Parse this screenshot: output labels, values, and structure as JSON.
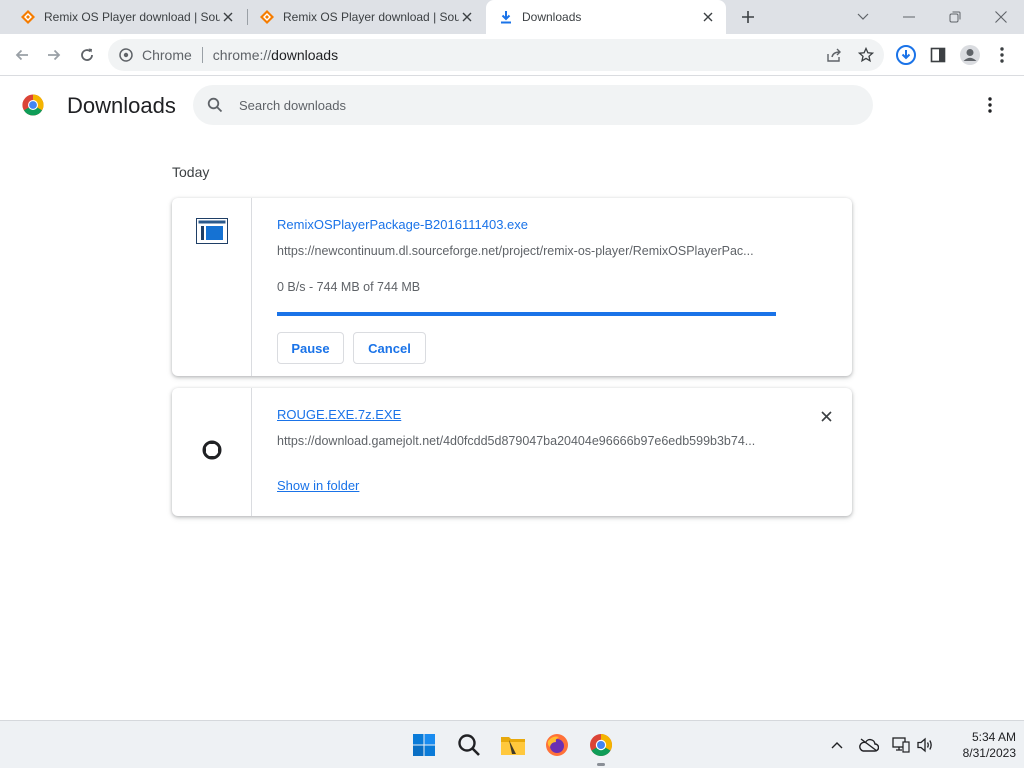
{
  "tabs": [
    {
      "title": "Remix OS Player download | SourceForge.net",
      "active": false
    },
    {
      "title": "Remix OS Player download | SourceForge.net",
      "active": false
    },
    {
      "title": "Downloads",
      "active": true
    }
  ],
  "toolbar": {
    "site_chip": "Chrome",
    "url_scheme": "chrome://",
    "url_rest": "downloads"
  },
  "page": {
    "title": "Downloads",
    "search_placeholder": "Search downloads",
    "section_date": "Today"
  },
  "downloads": [
    {
      "file_name": "RemixOSPlayerPackage-B2016111403.exe",
      "url": "https://newcontinuum.dl.sourceforge.net/project/remix-os-player/RemixOSPlayerPac...",
      "status": "0 B/s - 744 MB of 744 MB",
      "progress_fraction": 1.0,
      "pause_label": "Pause",
      "cancel_label": "Cancel"
    },
    {
      "file_name": "ROUGE.EXE.7z.EXE",
      "url": "https://download.gamejolt.net/4d0fcdd5d879047ba20404e96666b97e6edb599b3b74...",
      "show_in_folder_label": "Show in folder"
    }
  ],
  "taskbar": {
    "time": "5:34 AM",
    "date": "8/31/2023"
  },
  "colors": {
    "accent": "#1a73e8",
    "tabstrip": "#dee1e6",
    "taskbar": "#eef1f4"
  }
}
